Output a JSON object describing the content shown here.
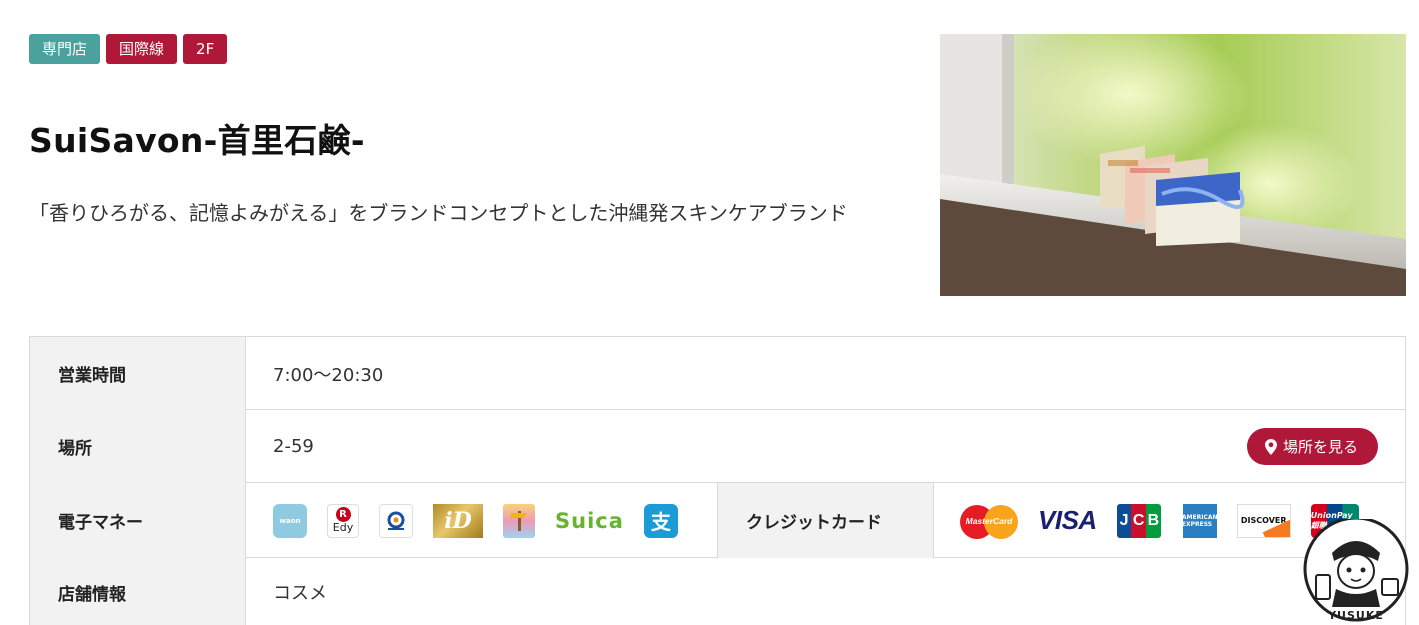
{
  "tags": [
    {
      "label": "専門店",
      "color": "#4aa19e"
    },
    {
      "label": "国際線",
      "color": "#b0183a"
    },
    {
      "label": "2F",
      "color": "#b0183a"
    }
  ],
  "shop": {
    "name": "SuiSavon-首里石鹸-",
    "description": "「香りひろがる、記憶よみがえる」をブランドコンセプトとした沖縄発スキンケアブランド"
  },
  "table": {
    "hours_label": "営業時間",
    "hours_value": "7:00～20:30",
    "location_label": "場所",
    "location_value": "2-59",
    "map_button": "場所を見る",
    "emoney_label": "電子マネー",
    "emoney_logos": {
      "waon": "waon",
      "edy_mark": "R",
      "edy": "Edy",
      "id": "iD",
      "suica": "Suica",
      "alipay": "支"
    },
    "credit_label": "クレジットカード",
    "credit_logos": {
      "mastercard": "MasterCard",
      "visa": "VISA",
      "jcb": [
        "J",
        "C",
        "B"
      ],
      "amex": "AMERICAN EXPRESS",
      "discover": "DISCOVER",
      "unionpay": "UnionPay 銀聯"
    },
    "info_label": "店舗情報",
    "info_value": "コスメ"
  },
  "badge": {
    "text": "YUSUKE"
  },
  "colors": {
    "accent": "#b0183a",
    "teal": "#4aa19e",
    "header_bg": "#f2f2f2"
  }
}
